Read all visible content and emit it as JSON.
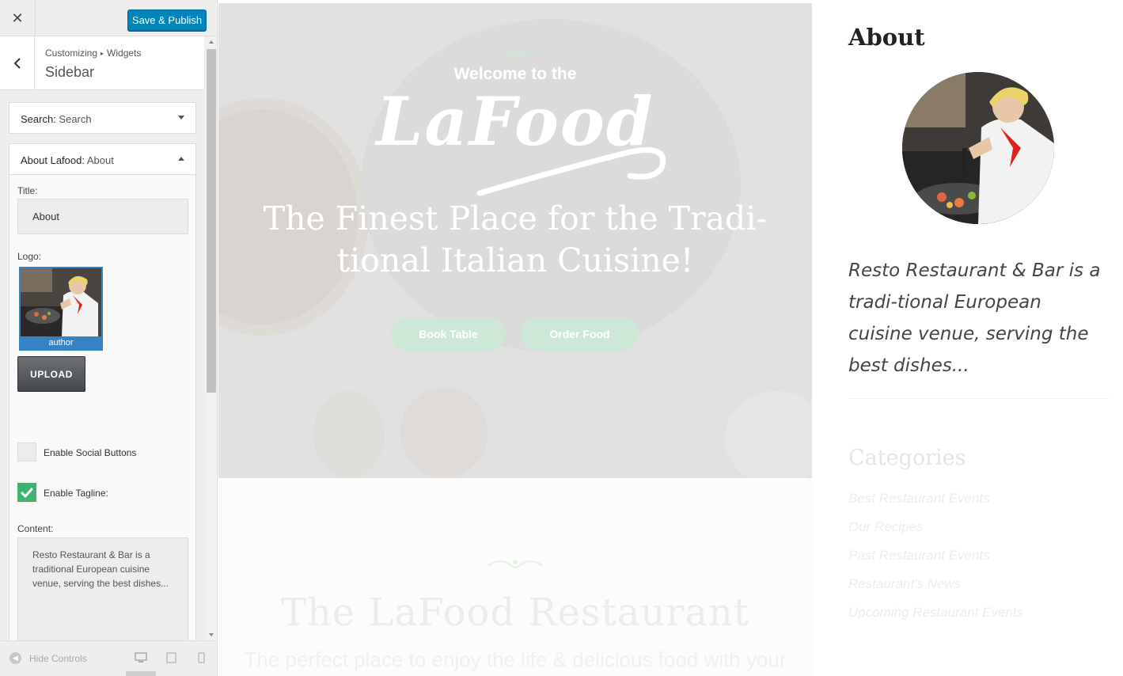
{
  "customizer": {
    "close_glyph": "✕",
    "publish_label": "Save & Publish",
    "breadcrumb": {
      "root": "Customizing",
      "separator": "▸",
      "current": "Widgets"
    },
    "section_title": "Sidebar",
    "widgets": [
      {
        "name": "Search:",
        "title": " Search",
        "state": "collapsed"
      },
      {
        "name": "About Lafood:",
        "title": " About",
        "state": "expanded"
      }
    ],
    "form": {
      "title_label": "Title:",
      "title_value": "About",
      "logo_label": "Logo:",
      "logo_caption": "author",
      "upload_label": "UPLOAD",
      "social_label": "Enable Social Buttons",
      "social_checked": false,
      "tagline_label": "Enable Tagline:",
      "tagline_checked": true,
      "content_label": "Content:",
      "content_value": "Resto Restaurant & Bar is a traditional European cuisine venue, serving the best dishes..."
    },
    "footer": {
      "hide_controls": "Hide Controls",
      "devices": [
        "desktop-icon",
        "tablet-icon",
        "mobile-icon"
      ]
    }
  },
  "preview": {
    "hero": {
      "welcome": "Welcome to the",
      "brand": "LaFood",
      "headline": "The Finest Place for the Tradi-tional Italian Cuisine!",
      "buttons": [
        "Book Table",
        "Order Food"
      ],
      "button_color": "#cde8d6"
    },
    "section": {
      "title": "The LaFood Restaurant",
      "subtitle": "The perfect place to enjoy the life & delicious food with your"
    },
    "sidebar": {
      "about_title": "About",
      "about_text": "Resto Restaurant & Bar is a tradi-tional European cuisine venue, serving the best dishes...",
      "categories_title": "Categories",
      "categories": [
        "Best Restaurant Events",
        "Our Recipes",
        "Past Restaurant Events",
        "Restaurant's News",
        "Upcoming Restaurant Events"
      ]
    }
  },
  "colors": {
    "accent": "#0085ba",
    "checkbox_on": "#3cb371",
    "logo_border": "#3582c4"
  }
}
